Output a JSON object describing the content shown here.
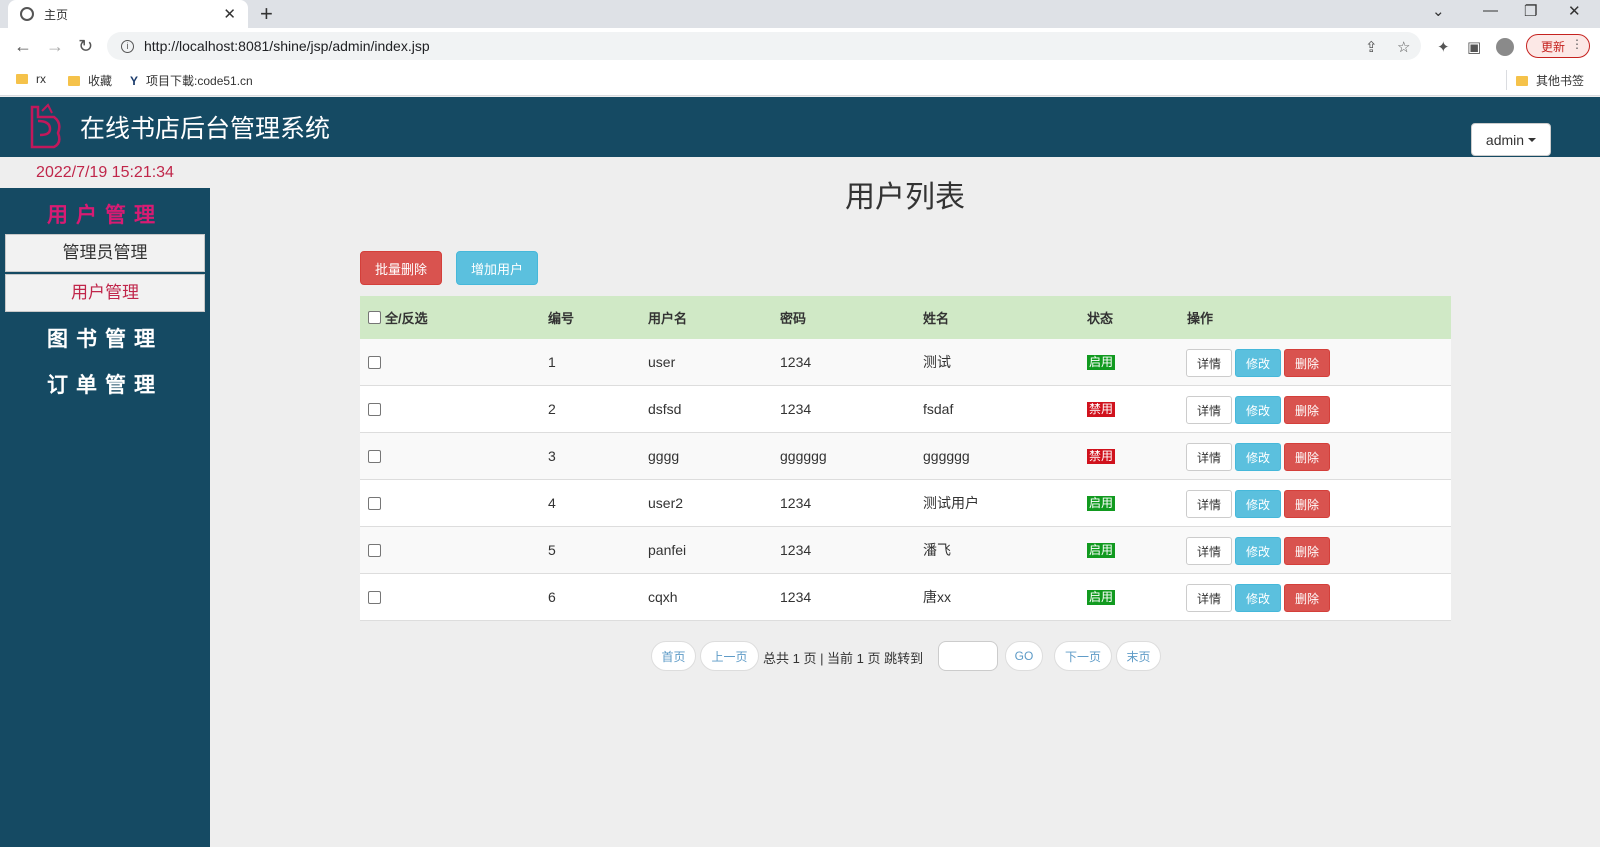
{
  "browser": {
    "tab_title": "主页",
    "url": "http://localhost:8081/shine/jsp/admin/index.jsp",
    "update_label": "更新",
    "bookmarks": [
      "rx",
      "收藏",
      "项目下載:code51.cn"
    ],
    "other_bookmarks": "其他书签"
  },
  "header": {
    "title": "在线书店后台管理系统",
    "user": "admin"
  },
  "datetime": "2022/7/19 15:21:34",
  "sidebar": {
    "groups": [
      {
        "label": "用户管理",
        "color": "#d81b73"
      },
      {
        "label": "图书管理",
        "color": "#ffffff"
      },
      {
        "label": "订单管理",
        "color": "#ffffff"
      }
    ],
    "items": [
      {
        "label": "管理员管理",
        "color": "#333333"
      },
      {
        "label": "用户管理",
        "color": "#c0264a"
      }
    ]
  },
  "main": {
    "title": "用户列表",
    "batch_delete": "批量删除",
    "add_user": "增加用户"
  },
  "table": {
    "headers": [
      "全/反选",
      "编号",
      "用户名",
      "密码",
      "姓名",
      "状态",
      "操作"
    ],
    "rows": [
      {
        "id": "1",
        "username": "user",
        "password": "1234",
        "name": "测试",
        "status": "启用"
      },
      {
        "id": "2",
        "username": "dsfsd",
        "password": "1234",
        "name": "fsdaf",
        "status": "禁用"
      },
      {
        "id": "3",
        "username": "gggg",
        "password": "gggggg",
        "name": "gggggg",
        "status": "禁用"
      },
      {
        "id": "4",
        "username": "user2",
        "password": "1234",
        "name": "测试用户",
        "status": "启用"
      },
      {
        "id": "5",
        "username": "panfei",
        "password": "1234",
        "name": "潘飞",
        "status": "启用"
      },
      {
        "id": "6",
        "username": "cqxh",
        "password": "1234",
        "name": "唐xx",
        "status": "启用"
      }
    ],
    "actions": {
      "detail": "详情",
      "edit": "修改",
      "delete": "删除"
    }
  },
  "pager": {
    "first": "首页",
    "prev": "上一页",
    "info": "总共 1 页 | 当前 1 页 跳转到",
    "go": "GO",
    "next": "下一页",
    "last": "末页"
  },
  "colors": {
    "header_bg": "#154a63",
    "status_on": "#119a1f",
    "status_off": "#d0121d",
    "table_head": "#d0e9c6"
  }
}
